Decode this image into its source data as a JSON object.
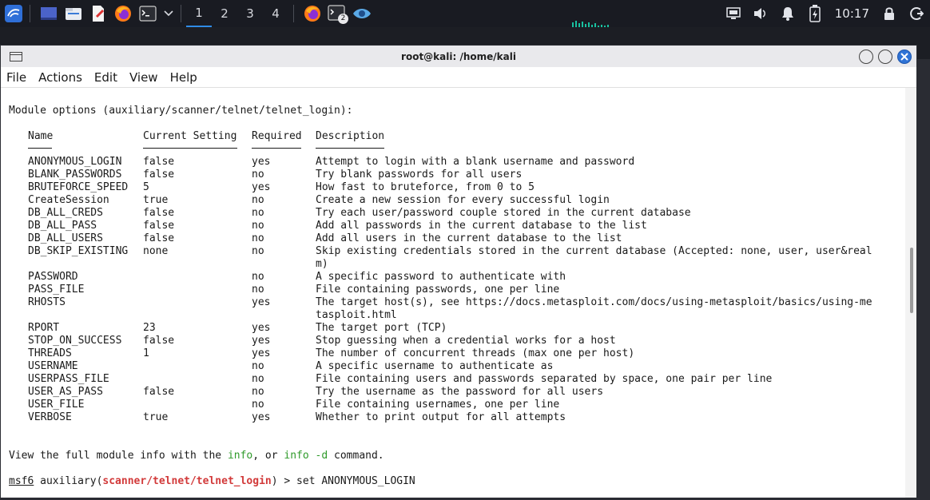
{
  "taskbar": {
    "workspaces": [
      "1",
      "2",
      "3",
      "4"
    ],
    "active_workspace": "1",
    "clock": "10:17",
    "terminal_badge": "2"
  },
  "terminal": {
    "title": "root@kali: /home/kali",
    "menu": [
      "File",
      "Actions",
      "Edit",
      "View",
      "Help"
    ]
  },
  "content": {
    "module_header": "Module options (auxiliary/scanner/telnet/telnet_login):",
    "columns": [
      "Name",
      "Current Setting",
      "Required",
      "Description"
    ],
    "rows": [
      {
        "name": "ANONYMOUS_LOGIN",
        "setting": "false",
        "required": "yes",
        "desc": "Attempt to login with a blank username and password"
      },
      {
        "name": "BLANK_PASSWORDS",
        "setting": "false",
        "required": "no",
        "desc": "Try blank passwords for all users"
      },
      {
        "name": "BRUTEFORCE_SPEED",
        "setting": "5",
        "required": "yes",
        "desc": "How fast to bruteforce, from 0 to 5"
      },
      {
        "name": "CreateSession",
        "setting": "true",
        "required": "no",
        "desc": "Create a new session for every successful login"
      },
      {
        "name": "DB_ALL_CREDS",
        "setting": "false",
        "required": "no",
        "desc": "Try each user/password couple stored in the current database"
      },
      {
        "name": "DB_ALL_PASS",
        "setting": "false",
        "required": "no",
        "desc": "Add all passwords in the current database to the list"
      },
      {
        "name": "DB_ALL_USERS",
        "setting": "false",
        "required": "no",
        "desc": "Add all users in the current database to the list"
      },
      {
        "name": "DB_SKIP_EXISTING",
        "setting": "none",
        "required": "no",
        "desc": "Skip existing credentials stored in the current database (Accepted: none, user, user&real",
        "desc2": "m)"
      },
      {
        "name": "PASSWORD",
        "setting": "",
        "required": "no",
        "desc": "A specific password to authenticate with"
      },
      {
        "name": "PASS_FILE",
        "setting": "",
        "required": "no",
        "desc": "File containing passwords, one per line"
      },
      {
        "name": "RHOSTS",
        "setting": "",
        "required": "yes",
        "desc": "The target host(s), see https://docs.metasploit.com/docs/using-metasploit/basics/using-me",
        "desc2": "tasploit.html"
      },
      {
        "name": "RPORT",
        "setting": "23",
        "required": "yes",
        "desc": "The target port (TCP)"
      },
      {
        "name": "STOP_ON_SUCCESS",
        "setting": "false",
        "required": "yes",
        "desc": "Stop guessing when a credential works for a host"
      },
      {
        "name": "THREADS",
        "setting": "1",
        "required": "yes",
        "desc": "The number of concurrent threads (max one per host)"
      },
      {
        "name": "USERNAME",
        "setting": "",
        "required": "no",
        "desc": "A specific username to authenticate as"
      },
      {
        "name": "USERPASS_FILE",
        "setting": "",
        "required": "no",
        "desc": "File containing users and passwords separated by space, one pair per line"
      },
      {
        "name": "USER_AS_PASS",
        "setting": "false",
        "required": "no",
        "desc": "Try the username as the password for all users"
      },
      {
        "name": "USER_FILE",
        "setting": "",
        "required": "no",
        "desc": "File containing usernames, one per line"
      },
      {
        "name": "VERBOSE",
        "setting": "true",
        "required": "yes",
        "desc": "Whether to print output for all attempts"
      }
    ],
    "info_line": {
      "part1": "View the full module info with the ",
      "cmd1": "info",
      "part2": ", or ",
      "cmd2": "info -d",
      "part3": " command."
    },
    "prompt": {
      "msf": "msf6",
      "module_prefix": " auxiliary(",
      "module": "scanner/telnet/telnet_login",
      "module_suffix": ") > ",
      "command": "set ANONYMOUS_LOGIN"
    }
  },
  "colors": {
    "accent_blue": "#2f73d6",
    "prompt_red": "#d23a3a",
    "cmd_green": "#2f9a2a"
  }
}
